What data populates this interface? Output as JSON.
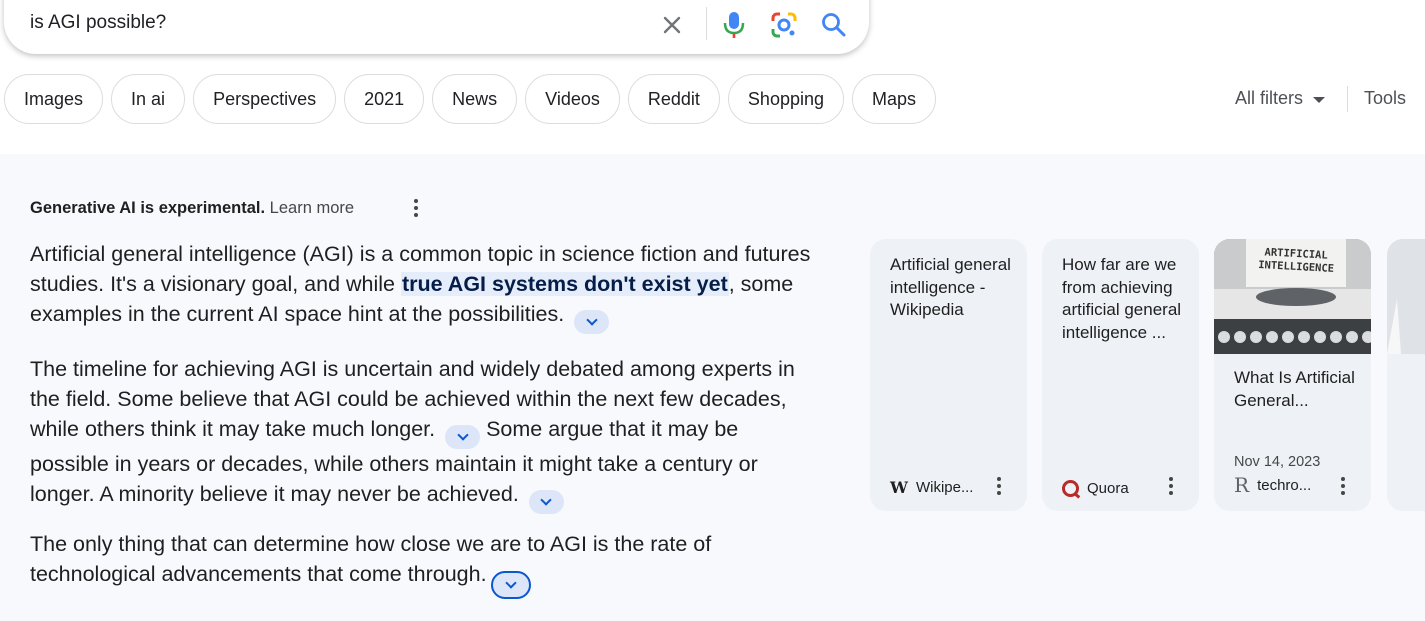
{
  "search": {
    "query": "is AGI possible?"
  },
  "chips": [
    "Images",
    "In ai",
    "Perspectives",
    "2021",
    "News",
    "Videos",
    "Reddit",
    "Shopping",
    "Maps"
  ],
  "filters": {
    "all_filters": "All filters",
    "tools": "Tools"
  },
  "overview": {
    "notice": "Generative AI is experimental.",
    "learn_more": "Learn more",
    "p1_a": "Artificial general intelligence (AGI) is a common topic in science fiction and futures studies. It's a visionary goal, and while ",
    "p1_highlight": "true AGI systems don't exist yet",
    "p1_b": ", some examples in the current AI space hint at the possibilities.",
    "p2_a": "The timeline for achieving AGI is uncertain and widely debated among experts in the field. Some believe that AGI could be achieved within the next few decades, while others think it may take much longer.",
    "p2_b": " Some argue that it may be possible in years or decades, while others maintain it might take a century or longer. A minority believe it may never be achieved.",
    "p3": "The only thing that can determine how close we are to AGI is the rate of technological advancements that come through."
  },
  "sources": [
    {
      "title": "Artificial general intelligence - Wikipedia",
      "source": "Wikipe...",
      "icon": "wikipedia-icon"
    },
    {
      "title": "How far are we from achieving artificial general intelligence ...",
      "source": "Quora",
      "icon": "quora-icon"
    },
    {
      "title": "What Is Artificial General...",
      "date": "Nov 14, 2023",
      "source": "techro...",
      "icon": "techrocket-icon",
      "image_text": "ARTIFICIAL INTELLIGENCE"
    }
  ],
  "colors": {
    "accent": "#0b57d0",
    "panel_bg": "#f7f9fd",
    "card_bg": "#eef1f6",
    "highlight_bg": "#e6edfa"
  }
}
